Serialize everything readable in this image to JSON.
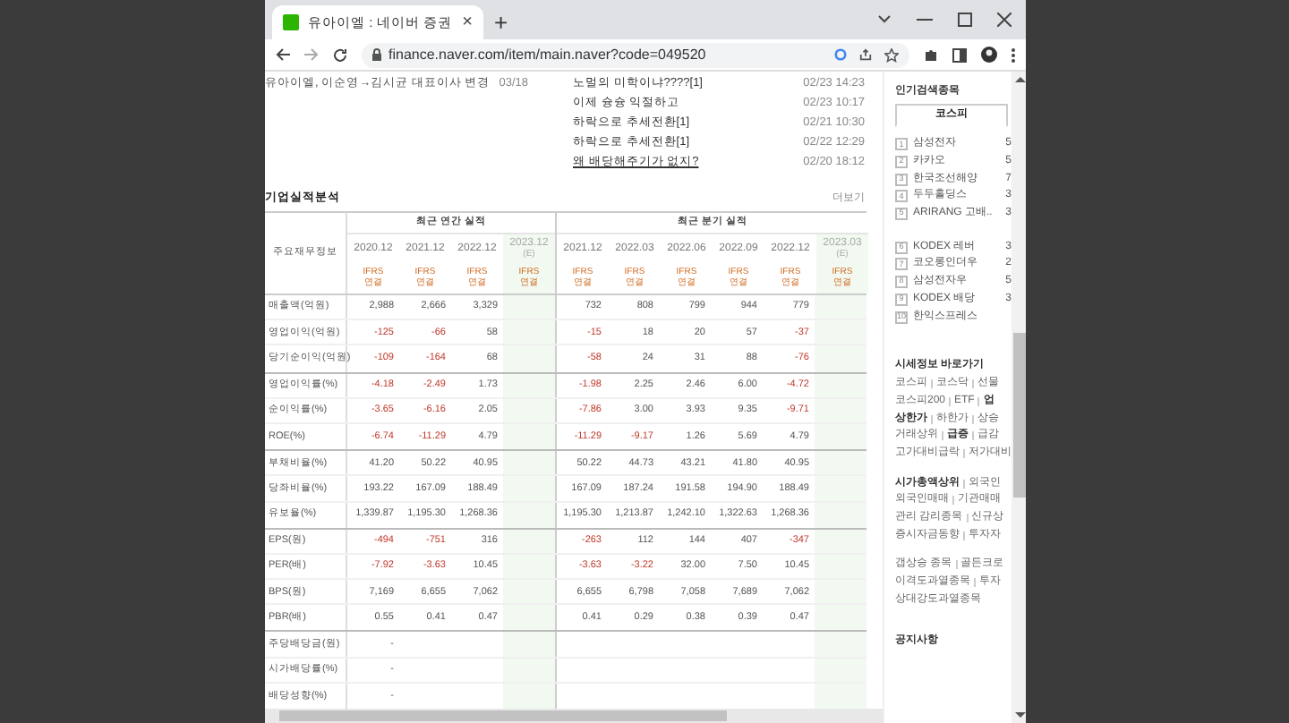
{
  "browser": {
    "tab_title": "유아이엘 : 네이버 증권",
    "close": "×",
    "new_tab": "+",
    "url": "finance.naver.com/item/main.naver?code=049520"
  },
  "news": {
    "title": "유아이엘, 이순영→김시균 대표이사 변경",
    "date": "03/18"
  },
  "board": [
    {
      "title": "노멀의 미학이냐????[1]",
      "date": "02/23 14:23",
      "underlined": false
    },
    {
      "title": "이제 슝슝 익절하고",
      "date": "02/23 10:17",
      "underlined": false
    },
    {
      "title": "하락으로 추세전환[1]",
      "date": "02/21 10:30",
      "underlined": false
    },
    {
      "title": "하락으로 추세전환[1]",
      "date": "02/22 12:29",
      "underlined": false
    },
    {
      "title": "왜 배당해주기가 없지?",
      "date": "02/20 18:12",
      "underlined": true
    }
  ],
  "performance": {
    "title": "기업실적분석",
    "more": "더보기",
    "corner": "주요재무정보",
    "groups": [
      {
        "label": "최근 연간 실적",
        "columns": [
          {
            "period": "2020.12",
            "estimate": false,
            "standard": "IFRS",
            "basis": "연결"
          },
          {
            "period": "2021.12",
            "estimate": false,
            "standard": "IFRS",
            "basis": "연결"
          },
          {
            "period": "2022.12",
            "estimate": false,
            "standard": "IFRS",
            "basis": "연결"
          },
          {
            "period": "2023.12",
            "note": "(E)",
            "estimate": true,
            "standard": "IFRS",
            "basis": "연결"
          }
        ]
      },
      {
        "label": "최근 분기 실적",
        "columns": [
          {
            "period": "2021.12",
            "estimate": false,
            "standard": "IFRS",
            "basis": "연결"
          },
          {
            "period": "2022.03",
            "estimate": false,
            "standard": "IFRS",
            "basis": "연결"
          },
          {
            "period": "2022.06",
            "estimate": false,
            "standard": "IFRS",
            "basis": "연결"
          },
          {
            "period": "2022.09",
            "estimate": false,
            "standard": "IFRS",
            "basis": "연결"
          },
          {
            "period": "2022.12",
            "estimate": false,
            "standard": "IFRS",
            "basis": "연결"
          },
          {
            "period": "2023.03",
            "note": "(E)",
            "estimate": true,
            "standard": "IFRS",
            "basis": "연결"
          }
        ]
      }
    ],
    "row_groups": [
      [
        {
          "label": "매출액(억원)",
          "values": [
            {
              "text": "2,988",
              "negative": false
            },
            {
              "text": "2,666",
              "negative": false
            },
            {
              "text": "3,329",
              "negative": false
            },
            {
              "text": "732",
              "negative": false
            },
            {
              "text": "808",
              "negative": false
            },
            {
              "text": "799",
              "negative": false
            },
            {
              "text": "944",
              "negative": false
            },
            {
              "text": "779",
              "negative": false
            }
          ]
        },
        {
          "label": "영업이익(억원)",
          "values": [
            {
              "text": "-125",
              "negative": true
            },
            {
              "text": "-66",
              "negative": true
            },
            {
              "text": "58",
              "negative": false
            },
            {
              "text": "-15",
              "negative": true
            },
            {
              "text": "18",
              "negative": false
            },
            {
              "text": "20",
              "negative": false
            },
            {
              "text": "57",
              "negative": false
            },
            {
              "text": "-37",
              "negative": true
            }
          ]
        },
        {
          "label": "당기순이익(억원)",
          "values": [
            {
              "text": "-109",
              "negative": true
            },
            {
              "text": "-164",
              "negative": true
            },
            {
              "text": "68",
              "negative": false
            },
            {
              "text": "-58",
              "negative": true
            },
            {
              "text": "24",
              "negative": false
            },
            {
              "text": "31",
              "negative": false
            },
            {
              "text": "88",
              "negative": false
            },
            {
              "text": "-76",
              "negative": true
            }
          ]
        }
      ],
      [
        {
          "label": "영업이익률(%)",
          "values": [
            {
              "text": "-4.18",
              "negative": true
            },
            {
              "text": "-2.49",
              "negative": true
            },
            {
              "text": "1.73",
              "negative": false
            },
            {
              "text": "-1.98",
              "negative": true
            },
            {
              "text": "2.25",
              "negative": false
            },
            {
              "text": "2.46",
              "negative": false
            },
            {
              "text": "6.00",
              "negative": false
            },
            {
              "text": "-4.72",
              "negative": true
            }
          ]
        },
        {
          "label": "순이익률(%)",
          "values": [
            {
              "text": "-3.65",
              "negative": true
            },
            {
              "text": "-6.16",
              "negative": true
            },
            {
              "text": "2.05",
              "negative": false
            },
            {
              "text": "-7.86",
              "negative": true
            },
            {
              "text": "3.00",
              "negative": false
            },
            {
              "text": "3.93",
              "negative": false
            },
            {
              "text": "9.35",
              "negative": false
            },
            {
              "text": "-9.71",
              "negative": true
            }
          ]
        },
        {
          "label": "ROE(%)",
          "values": [
            {
              "text": "-6.74",
              "negative": true
            },
            {
              "text": "-11.29",
              "negative": true
            },
            {
              "text": "4.79",
              "negative": false
            },
            {
              "text": "-11.29",
              "negative": true
            },
            {
              "text": "-9.17",
              "negative": true
            },
            {
              "text": "1.26",
              "negative": false
            },
            {
              "text": "5.69",
              "negative": false
            },
            {
              "text": "4.79",
              "negative": false
            }
          ]
        }
      ],
      [
        {
          "label": "부채비율(%)",
          "values": [
            {
              "text": "41.20",
              "negative": false
            },
            {
              "text": "50.22",
              "negative": false
            },
            {
              "text": "40.95",
              "negative": false
            },
            {
              "text": "50.22",
              "negative": false
            },
            {
              "text": "44.73",
              "negative": false
            },
            {
              "text": "43.21",
              "negative": false
            },
            {
              "text": "41.80",
              "negative": false
            },
            {
              "text": "40.95",
              "negative": false
            }
          ]
        },
        {
          "label": "당좌비율(%)",
          "values": [
            {
              "text": "193.22",
              "negative": false
            },
            {
              "text": "167.09",
              "negative": false
            },
            {
              "text": "188.49",
              "negative": false
            },
            {
              "text": "167.09",
              "negative": false
            },
            {
              "text": "187.24",
              "negative": false
            },
            {
              "text": "191.58",
              "negative": false
            },
            {
              "text": "194.90",
              "negative": false
            },
            {
              "text": "188.49",
              "negative": false
            }
          ]
        },
        {
          "label": "유보율(%)",
          "values": [
            {
              "text": "1,339.87",
              "negative": false
            },
            {
              "text": "1,195.30",
              "negative": false
            },
            {
              "text": "1,268.36",
              "negative": false
            },
            {
              "text": "1,195.30",
              "negative": false
            },
            {
              "text": "1,213.87",
              "negative": false
            },
            {
              "text": "1,242.10",
              "negative": false
            },
            {
              "text": "1,322.63",
              "negative": false
            },
            {
              "text": "1,268.36",
              "negative": false
            }
          ]
        }
      ],
      [
        {
          "label": "EPS(원)",
          "values": [
            {
              "text": "-494",
              "negative": true
            },
            {
              "text": "-751",
              "negative": true
            },
            {
              "text": "316",
              "negative": false
            },
            {
              "text": "-263",
              "negative": true
            },
            {
              "text": "112",
              "negative": false
            },
            {
              "text": "144",
              "negative": false
            },
            {
              "text": "407",
              "negative": false
            },
            {
              "text": "-347",
              "negative": true
            }
          ]
        },
        {
          "label": "PER(배)",
          "values": [
            {
              "text": "-7.92",
              "negative": true
            },
            {
              "text": "-3.63",
              "negative": true
            },
            {
              "text": "10.45",
              "negative": false
            },
            {
              "text": "-3.63",
              "negative": true
            },
            {
              "text": "-3.22",
              "negative": true
            },
            {
              "text": "32.00",
              "negative": false
            },
            {
              "text": "7.50",
              "negative": false
            },
            {
              "text": "10.45",
              "negative": false
            }
          ]
        },
        {
          "label": "BPS(원)",
          "values": [
            {
              "text": "7,169",
              "negative": false
            },
            {
              "text": "6,655",
              "negative": false
            },
            {
              "text": "7,062",
              "negative": false
            },
            {
              "text": "6,655",
              "negative": false
            },
            {
              "text": "6,798",
              "negative": false
            },
            {
              "text": "7,058",
              "negative": false
            },
            {
              "text": "7,689",
              "negative": false
            },
            {
              "text": "7,062",
              "negative": false
            }
          ]
        },
        {
          "label": "PBR(배)",
          "values": [
            {
              "text": "0.55",
              "negative": false
            },
            {
              "text": "0.41",
              "negative": false
            },
            {
              "text": "0.47",
              "negative": false
            },
            {
              "text": "0.41",
              "negative": false
            },
            {
              "text": "0.29",
              "negative": false
            },
            {
              "text": "0.38",
              "negative": false
            },
            {
              "text": "0.39",
              "negative": false
            },
            {
              "text": "0.47",
              "negative": false
            }
          ]
        }
      ],
      [
        {
          "label": "주당배당금(원)",
          "values": [
            {
              "text": "-",
              "negative": false
            }
          ]
        },
        {
          "label": "시가배당률(%)",
          "values": [
            {
              "text": "-",
              "negative": false
            }
          ]
        },
        {
          "label": "배당성향(%)",
          "values": [
            {
              "text": "-",
              "negative": false
            }
          ]
        }
      ]
    ]
  },
  "sidebar": {
    "title": "인기검색종목",
    "tabs": [
      {
        "label": "코스피",
        "selected": true
      }
    ],
    "rank_groups": [
      [
        {
          "rank": "1",
          "name": "삼성전자",
          "value": "5"
        },
        {
          "rank": "2",
          "name": "카카오",
          "value": "5"
        },
        {
          "rank": "3",
          "name": "한국조선해양",
          "value": "7"
        },
        {
          "rank": "4",
          "name": "두두홀딩스",
          "value": "3"
        },
        {
          "rank": "5",
          "name": "ARIRANG 고배..",
          "value": "3"
        }
      ],
      [
        {
          "rank": "6",
          "name": "KODEX 레버",
          "value": "3"
        },
        {
          "rank": "7",
          "name": "코오롱인더우",
          "value": "2"
        },
        {
          "rank": "8",
          "name": "삼성전자우",
          "value": "5"
        },
        {
          "rank": "9",
          "name": "KODEX 배당",
          "value": "3"
        },
        {
          "rank": "10",
          "name": "한익스프레스"
        }
      ]
    ],
    "quick_title": "시세정보 바로가기",
    "link_groups": [
      [
        [
          {
            "text": "코스피",
            "bold": false
          },
          {
            "text": "코스닥",
            "bold": false
          },
          {
            "text": "선물",
            "bold": false
          }
        ],
        [
          {
            "text": "코스피200",
            "bold": false
          },
          {
            "text": "ETF",
            "bold": false
          },
          {
            "text": "업",
            "bold": true
          }
        ],
        [
          {
            "text": "상한가",
            "bold": true
          },
          {
            "text": "하한가",
            "bold": false
          },
          {
            "text": "상승",
            "bold": false
          }
        ],
        [
          {
            "text": "거래상위",
            "bold": false
          },
          {
            "text": "급증",
            "bold": true
          },
          {
            "text": "급감",
            "bold": false
          }
        ],
        [
          {
            "text": "고가대비급락",
            "bold": false
          },
          {
            "text": "저가대비",
            "bold": false
          }
        ]
      ],
      [
        [
          {
            "text": "시가총액상위",
            "bold": true
          },
          {
            "text": "외국인",
            "bold": false
          }
        ],
        [
          {
            "text": "외국인매매",
            "bold": false
          },
          {
            "text": "기관매매",
            "bold": false
          }
        ],
        [
          {
            "text": "관리 감리종목",
            "bold": false
          },
          {
            "text": "신규상",
            "bold": false
          }
        ],
        [
          {
            "text": "증시자금동향",
            "bold": false
          },
          {
            "text": "투자자",
            "bold": false
          }
        ]
      ],
      [
        [
          {
            "text": "갭상승 종목",
            "bold": false
          },
          {
            "text": "골든크로",
            "bold": false
          }
        ],
        [
          {
            "text": "이격도과열종목",
            "bold": false
          },
          {
            "text": "투자",
            "bold": false
          }
        ],
        [
          {
            "text": "상대강도과열종목",
            "bold": false
          }
        ]
      ]
    ],
    "notice_title": "공지사항"
  }
}
